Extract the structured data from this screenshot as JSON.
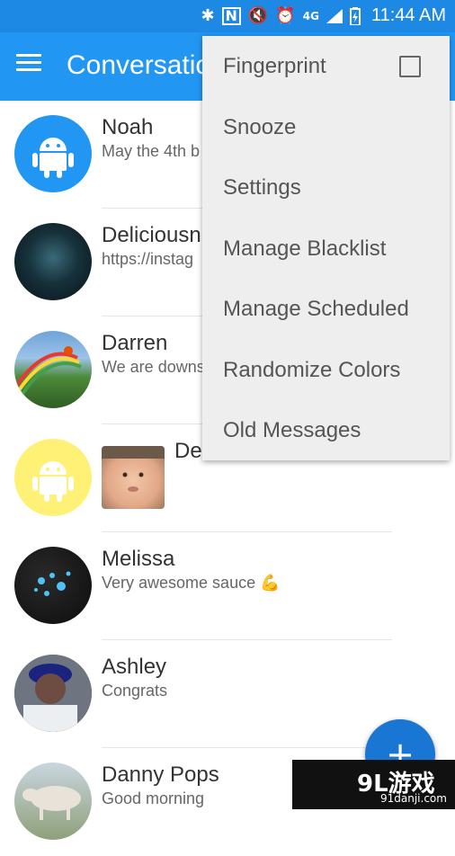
{
  "statusbar": {
    "time": "11:44 AM",
    "icons": [
      "bluetooth-icon",
      "nfc-icon",
      "mute-icon",
      "alarm-icon",
      "4g-icon",
      "signal-icon",
      "battery-charging-icon"
    ],
    "network_label": "4G"
  },
  "appbar": {
    "title": "Conversations",
    "menu_icon": "hamburger-icon",
    "color": "#2196f3"
  },
  "conversations": [
    {
      "name": "Noah",
      "message": "May the 4th b",
      "avatar": "android",
      "avatar_color": "#2196f3"
    },
    {
      "name": "Deliciousn",
      "message": "https://instag",
      "avatar": "photo-dark",
      "avatar_color": "#102028"
    },
    {
      "name": "Darren",
      "message": "We are downs",
      "avatar": "photo-rainbow",
      "avatar_color": "#3b7a3b"
    },
    {
      "name": "De",
      "message": "",
      "avatar": "android",
      "avatar_color": "#fff176"
    },
    {
      "name": "Melissa",
      "message": "Very awesome sauce 💪",
      "avatar": "photo-drops",
      "avatar_color": "#1a1a1a"
    },
    {
      "name": "Ashley",
      "message": "Congrats",
      "avatar": "photo-person",
      "avatar_color": "#4a4a4a"
    },
    {
      "name": "Danny Pops",
      "message": "Good morning",
      "avatar": "photo-cow",
      "avatar_color": "#8a9a7a"
    }
  ],
  "overflow_menu": {
    "items": [
      {
        "label": "Fingerprint",
        "has_checkbox": true,
        "checked": false
      },
      {
        "label": "Snooze"
      },
      {
        "label": "Settings"
      },
      {
        "label": "Manage Blacklist"
      },
      {
        "label": "Manage Scheduled"
      },
      {
        "label": "Randomize Colors"
      },
      {
        "label": "Old Messages"
      }
    ]
  },
  "fab": {
    "label": "+",
    "color": "#1976d2"
  },
  "watermark": {
    "main": "9L游戏",
    "sub": "91danji.com"
  }
}
